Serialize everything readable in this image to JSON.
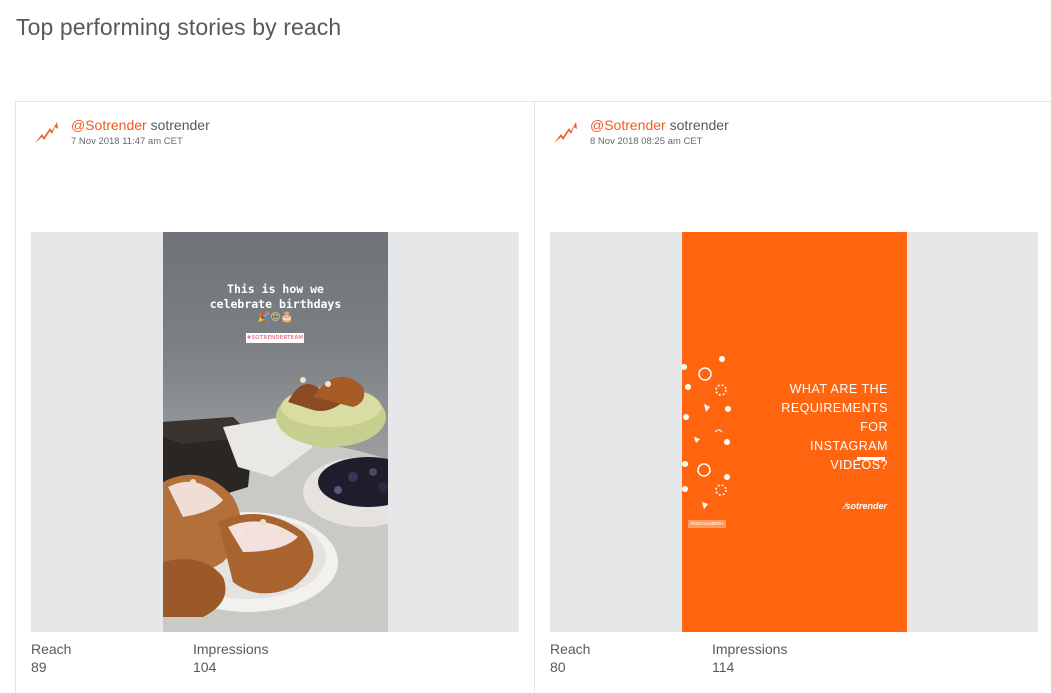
{
  "page": {
    "title": "Top performing stories by reach"
  },
  "colors": {
    "accent": "#f15a22",
    "text": "#55595e",
    "story2_background": "#ff650f",
    "media_background": "#e6e7e9"
  },
  "stories": [
    {
      "handle": "@Sotrender",
      "name": "sotrender",
      "date": "7 Nov 2018 11:47 am CET",
      "logo_icon": "sotrender-logo-icon",
      "story_text": "This is how we\ncelebrate birthdays",
      "story_emoji": "🎉😊🎂",
      "story_tag": "#SOTRENDERTEAM",
      "reach_label": "Reach",
      "reach_value": "89",
      "impressions_label": "Impressions",
      "impressions_value": "104"
    },
    {
      "handle": "@Sotrender",
      "name": "sotrender",
      "date": "8 Nov 2018 08:25 am CET",
      "logo_icon": "sotrender-logo-icon",
      "story_text": "WHAT ARE THE\nREQUIREMENTS FOR\nINSTAGRAM VIDEOS?",
      "story_brand": "⁄sotrender",
      "story_tag": "#SOCIALMEDIA",
      "reach_label": "Reach",
      "reach_value": "80",
      "impressions_label": "Impressions",
      "impressions_value": "114"
    }
  ]
}
